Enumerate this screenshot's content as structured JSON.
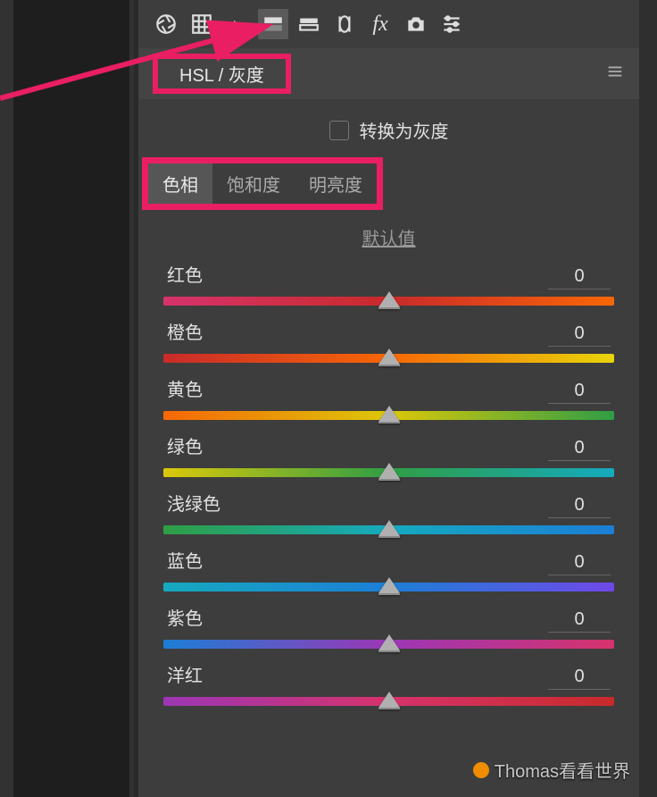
{
  "toolbar": {
    "icons": [
      "aperture-icon",
      "grid-icon",
      "mountain-icon",
      "gradient-icon",
      "split-icon",
      "lens-icon",
      "fx-icon",
      "camera-icon",
      "sliders-icon"
    ],
    "active_index": 3
  },
  "panel": {
    "title": "HSL / 灰度",
    "menu_icon": "menu-icon"
  },
  "grayscale": {
    "label": "转换为灰度",
    "checked": false
  },
  "tabs": {
    "items": [
      "色相",
      "饱和度",
      "明亮度"
    ],
    "active_index": 0
  },
  "default_link": "默认值",
  "sliders": [
    {
      "label": "红色",
      "value": 0,
      "gradient": "g-red"
    },
    {
      "label": "橙色",
      "value": 0,
      "gradient": "g-orange"
    },
    {
      "label": "黄色",
      "value": 0,
      "gradient": "g-yellow"
    },
    {
      "label": "绿色",
      "value": 0,
      "gradient": "g-green"
    },
    {
      "label": "浅绿色",
      "value": 0,
      "gradient": "g-aqua"
    },
    {
      "label": "蓝色",
      "value": 0,
      "gradient": "g-blue"
    },
    {
      "label": "紫色",
      "value": 0,
      "gradient": "g-purple"
    },
    {
      "label": "洋红",
      "value": 0,
      "gradient": "g-magenta"
    }
  ],
  "annotation": {
    "arrow_color": "#e91e63",
    "highlight_color": "#e91e63"
  },
  "watermark": "Thomas看看世界"
}
